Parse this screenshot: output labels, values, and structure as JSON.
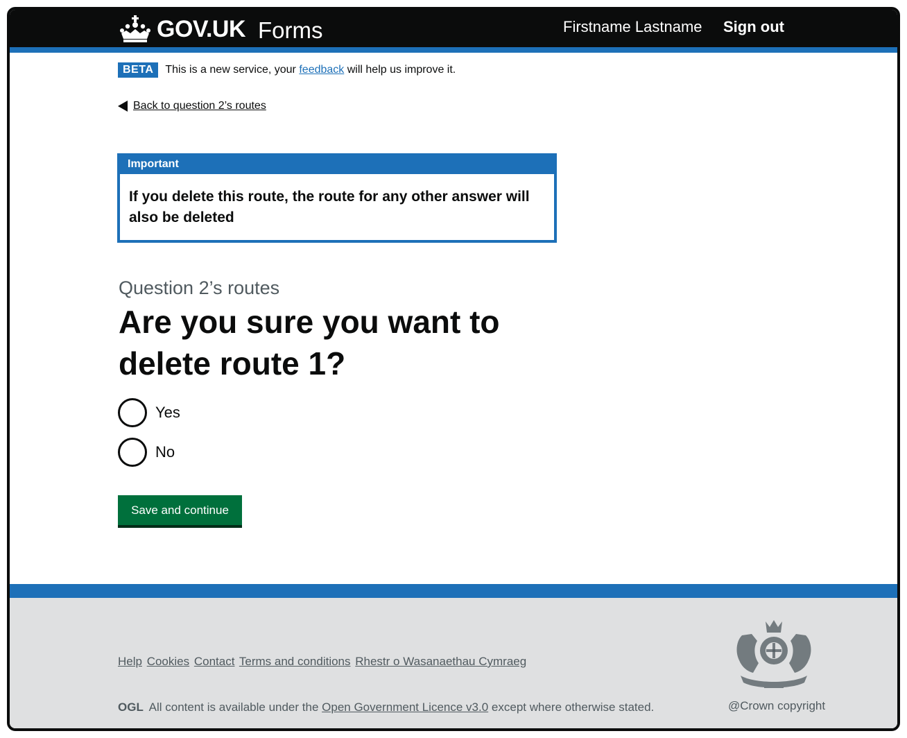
{
  "header": {
    "logo_text": "GOV.UK",
    "service_name": "Forms",
    "user_name": "Firstname Lastname",
    "sign_out": "Sign out"
  },
  "phase_banner": {
    "tag": "BETA",
    "text_before": "This is a new service, your",
    "link": "feedback",
    "text_after": "will help us improve it."
  },
  "back_link": "Back to question 2’s routes",
  "notification": {
    "title": "Important",
    "body": "If you delete this route, the route for any other answer will also be deleted"
  },
  "caption": "Question 2’s routes",
  "heading": "Are you sure you want to delete route 1?",
  "radios": [
    {
      "label": "Yes",
      "checked": false
    },
    {
      "label": "No",
      "checked": false
    }
  ],
  "button": "Save and continue",
  "footer": {
    "links": [
      "Help",
      "Cookies",
      "Contact",
      "Terms and conditions",
      "Rhestr o Wasanaethau Cymraeg"
    ],
    "ogl": "OGL",
    "licence_before": "All content is available under the",
    "licence_link": "Open Government Licence v3.0",
    "licence_after": "except where otherwise stated.",
    "copyright": "@Crown copyright"
  },
  "colors": {
    "header_bg": "#0b0c0c",
    "brand_blue": "#1d70b8",
    "button_green": "#00703c",
    "footer_bg": "#dfe0e1",
    "secondary_text": "#505a5f"
  }
}
